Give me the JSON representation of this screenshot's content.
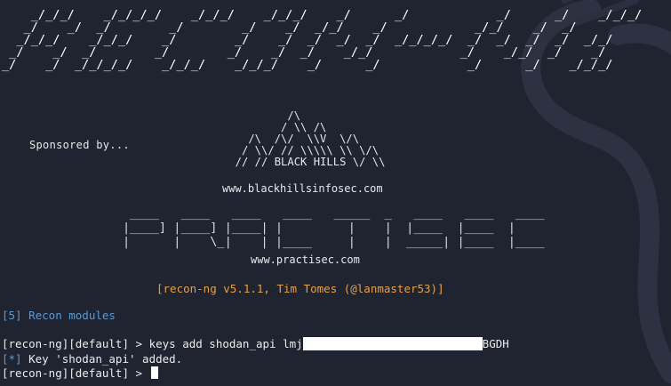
{
  "banner_art": "    _/_/_/    _/_/_/_/    _/_/_/    _/_/_/    _/      _/            _/      _/    _/_/_/\n   _/    _/  _/        _/        _/    _/  _/_/    _/            _/_/    _/  _/\n  _/_/_/    _/_/_/    _/        _/    _/  _/  _/  _/  _/_/_/_/  _/  _/  _/  _/  _/_/\n _/    _/  _/        _/        _/    _/  _/    _/_/            _/    _/_/  _/    _/\n_/    _/  _/_/_/_/    _/_/_/    _/_/_/    _/      _/            _/      _/    _/_/_/",
  "sponsor": {
    "label": "Sponsored by..."
  },
  "blackhills": {
    "art": "          /\\\n         / \\\\ /\\\n    /\\  /\\/  \\\\V  \\/\\\n   / \\\\/ // \\\\\\\\\\ \\\\ \\/\\\n  // // BLACK HILLS \\/ \\\\",
    "url": "www.blackhillsinfosec.com"
  },
  "practisec": {
    "art": " ____   ____   ____   ____   _____  _   ____   ____   ____\n|____] |____] |____| |         |    |  |____  |____  |\n|      |    \\_|    | |____     |    |  _____| |____  |____",
    "url": "www.practisec.com"
  },
  "version": "[recon-ng v5.1.1, Tim Tomes (@lanmaster53)]",
  "modules": "[5] Recon modules",
  "command": {
    "prompt": "[recon-ng][default] > ",
    "text": "keys add shodan_api lmj",
    "suffix": "BGDH"
  },
  "result": {
    "marker": "[*]",
    "message": " Key 'shodan_api' added."
  },
  "final_prompt": "[recon-ng][default] > ",
  "icons": {
    "watermark": "dragon-logo-icon",
    "cursor": "block-cursor-icon"
  },
  "colors": {
    "background": "#1f2430",
    "accent_blue": "#5b9bd5",
    "version_orange": "#e8a04a"
  }
}
